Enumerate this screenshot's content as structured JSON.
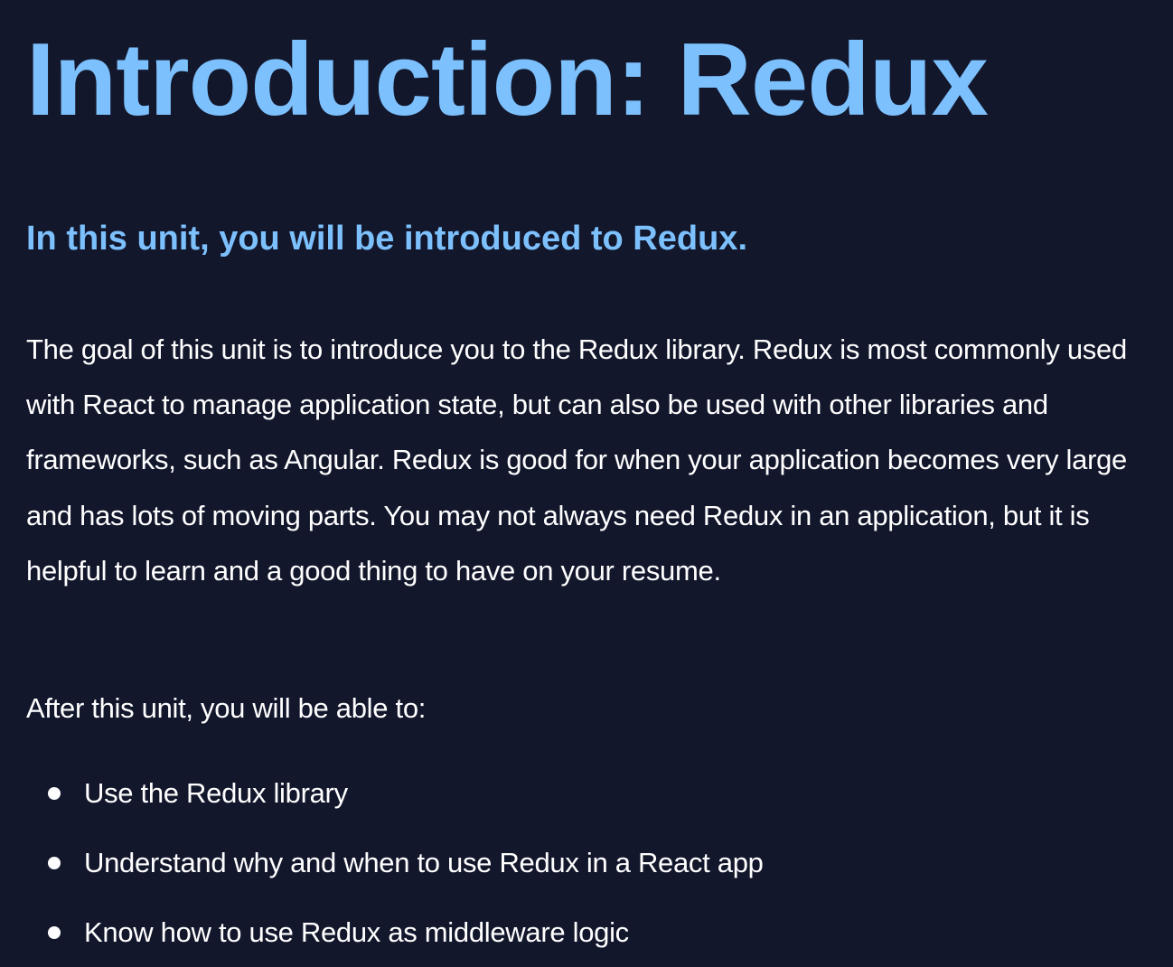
{
  "content": {
    "title": "Introduction: Redux",
    "subtitle": "In this unit, you will be introduced to Redux.",
    "intro": "The goal of this unit is to introduce you to the Redux library. Redux is most commonly used with React to manage application state, but can also be used with other libraries and frameworks, such as Angular. Redux is good for when your application becomes very large and has lots of moving parts. You may not always need Redux in an application, but it is helpful to learn and a good thing to have on your resume.",
    "lead": "After this unit, you will be able to:",
    "outcomes": [
      "Use the Redux library",
      "Understand why and when to use Redux in a React app",
      "Know how to use Redux as middleware logic"
    ]
  },
  "colors": {
    "background": "#13172c",
    "heading": "#7cc0fd",
    "text": "#ffffff"
  }
}
